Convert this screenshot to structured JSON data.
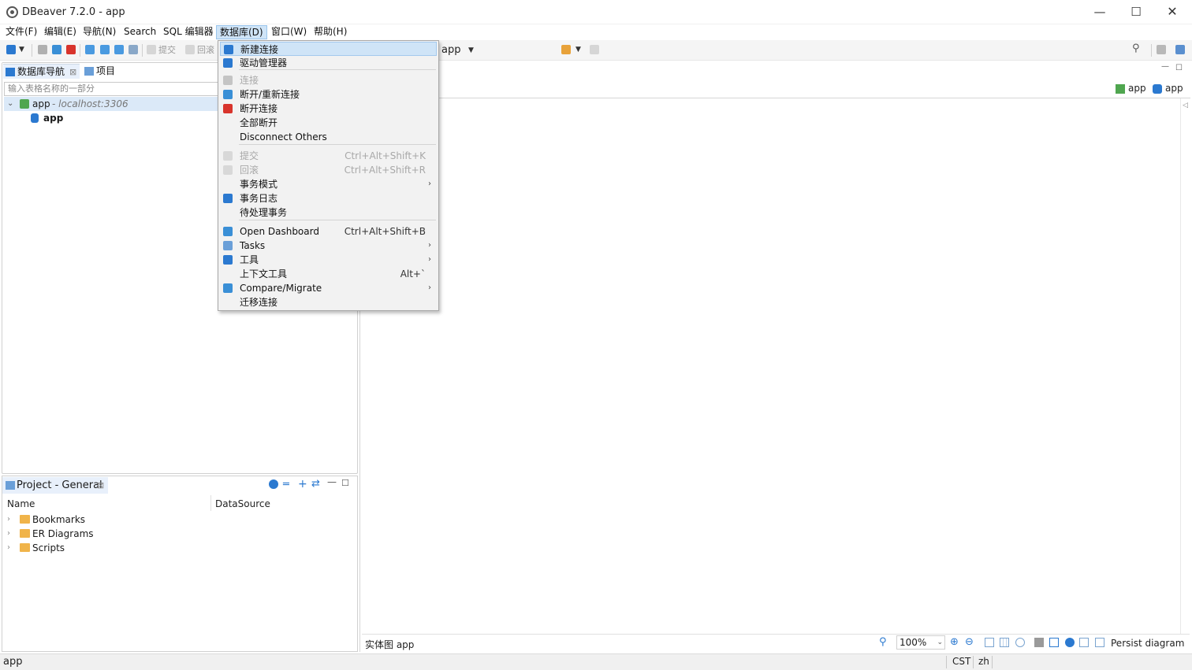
{
  "window": {
    "title": "DBeaver 7.2.0 - app",
    "min": "—",
    "max": "☐",
    "close": "✕"
  },
  "menubar": {
    "items": [
      "文件(F)",
      "编辑(E)",
      "导航(N)",
      "Search",
      "SQL 编辑器",
      "数据库(D)",
      "窗口(W)",
      "帮助(H)"
    ]
  },
  "toolbar": {
    "commit_label": "提交",
    "rollback_label": "回滚",
    "datasource_combo": "app"
  },
  "nav_panel": {
    "tabs": [
      "数据库导航",
      "项目"
    ],
    "filter_placeholder": "输入表格名称的一部分",
    "tree": {
      "connection_name": "app",
      "connection_host": " - localhost:3306",
      "database_name": "app"
    }
  },
  "project_panel": {
    "title": "Project - General",
    "columns": [
      "Name",
      "DataSource"
    ],
    "rows": [
      "Bookmarks",
      "ER Diagrams",
      "Scripts"
    ]
  },
  "editor": {
    "breadcrumbs": [
      "app",
      "app"
    ],
    "diagram_name": "实体图 app",
    "zoom": "100%",
    "persist_label": "Persist diagram"
  },
  "dropdown": {
    "items": [
      {
        "label": "新建连接",
        "shortcut": "",
        "sub": "",
        "disabled": false,
        "hover": true,
        "icon": "new-connection-icon"
      },
      {
        "label": "驱动管理器",
        "shortcut": "",
        "sub": "",
        "disabled": false,
        "hover": false,
        "icon": "driver-manager-icon"
      },
      {
        "label": "连接",
        "shortcut": "",
        "sub": "",
        "disabled": true,
        "hover": false,
        "icon": "connect-icon"
      },
      {
        "label": "断开/重新连接",
        "shortcut": "",
        "sub": "",
        "disabled": false,
        "hover": false,
        "icon": "reconnect-icon"
      },
      {
        "label": "断开连接",
        "shortcut": "",
        "sub": "",
        "disabled": false,
        "hover": false,
        "icon": "disconnect-icon"
      },
      {
        "label": "全部断开",
        "shortcut": "",
        "sub": "",
        "disabled": false,
        "hover": false,
        "icon": ""
      },
      {
        "label": "Disconnect Others",
        "shortcut": "",
        "sub": "",
        "disabled": false,
        "hover": false,
        "icon": ""
      },
      {
        "label": "提交",
        "shortcut": "Ctrl+Alt+Shift+K",
        "sub": "",
        "disabled": true,
        "hover": false,
        "icon": "commit-icon"
      },
      {
        "label": "回滚",
        "shortcut": "Ctrl+Alt+Shift+R",
        "sub": "",
        "disabled": true,
        "hover": false,
        "icon": "rollback-icon"
      },
      {
        "label": "事务模式",
        "shortcut": "",
        "sub": "›",
        "disabled": false,
        "hover": false,
        "icon": ""
      },
      {
        "label": "事务日志",
        "shortcut": "",
        "sub": "",
        "disabled": false,
        "hover": false,
        "icon": "transaction-log-icon"
      },
      {
        "label": "待处理事务",
        "shortcut": "",
        "sub": "",
        "disabled": false,
        "hover": false,
        "icon": ""
      },
      {
        "label": "Open Dashboard",
        "shortcut": "Ctrl+Alt+Shift+B",
        "sub": "",
        "disabled": false,
        "hover": false,
        "icon": "dashboard-icon"
      },
      {
        "label": "Tasks",
        "shortcut": "",
        "sub": "›",
        "disabled": false,
        "hover": false,
        "icon": "tasks-icon"
      },
      {
        "label": "工具",
        "shortcut": "",
        "sub": "›",
        "disabled": false,
        "hover": false,
        "icon": "tools-icon"
      },
      {
        "label": "上下文工具",
        "shortcut": "Alt+`",
        "sub": "",
        "disabled": false,
        "hover": false,
        "icon": ""
      },
      {
        "label": "Compare/Migrate",
        "shortcut": "",
        "sub": "›",
        "disabled": false,
        "hover": false,
        "icon": "compare-icon"
      },
      {
        "label": "迁移连接",
        "shortcut": "",
        "sub": "",
        "disabled": false,
        "hover": false,
        "icon": ""
      }
    ]
  },
  "statusbar": {
    "left": "app",
    "timezone": "CST",
    "locale": "zh"
  },
  "colors": {
    "accent_blue": "#2b79d0",
    "menu_hover": "#cfe4f7",
    "disconnect_red": "#d8342c",
    "folder_orange": "#f0b44a"
  }
}
